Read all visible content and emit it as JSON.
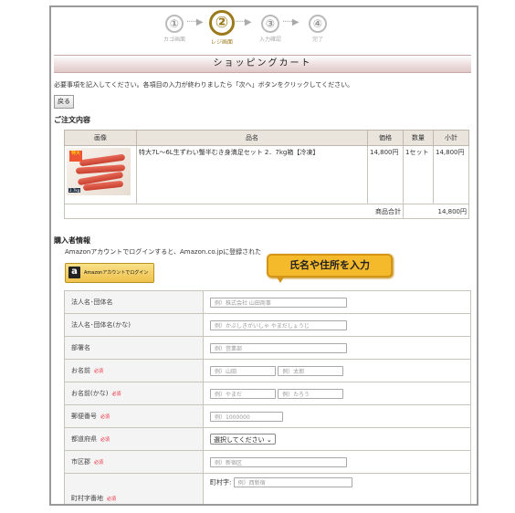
{
  "steps": [
    {
      "num": "①",
      "label": "カゴ画面"
    },
    {
      "num": "②",
      "label": "レジ画面"
    },
    {
      "num": "③",
      "label": "入力確認"
    },
    {
      "num": "④",
      "label": "完了"
    }
  ],
  "arrow": "·····▶",
  "banner_title": "ショッピングカート",
  "instructions": "必要事項を記入してください。各項目の入力が終わりましたら「次へ」ボタンをクリックしてください。",
  "back_label": "戻る",
  "order": {
    "section_title": "ご注文内容",
    "headers": [
      "画像",
      "品名",
      "価格",
      "数量",
      "小計"
    ],
    "item": {
      "name": "特大7L～6L生ずわい蟹半むき身満足セット 2．7kg箱【冷凍】",
      "price": "14,800円",
      "qty": "1セット",
      "subtotal": "14,800円"
    },
    "total_label": "商品合計",
    "total_value": "14,800円"
  },
  "buyer": {
    "section_title": "購入者情報",
    "amazon_hint": "Amazonアカウントでログインすると、Amazon.co.jpに登録された",
    "amazon_button": "Amazonアカウントでログイン",
    "amazon_logo": "a"
  },
  "callout": "氏名や住所を入力",
  "required_mark": "必須",
  "form": {
    "corp_label": "法人名･団体名",
    "corp_ph": "例）株式会社 山田商事",
    "corp_kana_label": "法人名･団体名(かな)",
    "corp_kana_ph": "例）かぶしきがいしゃ やまだしょうじ",
    "dept_label": "部署名",
    "dept_ph": "例）営業部",
    "name_label": "お名前",
    "last_ph": "例）山田",
    "first_ph": "例）太郎",
    "kana_label": "お名前(かな)",
    "last_kana_ph": "例）やまだ",
    "first_kana_ph": "例）たろう",
    "zip_label": "郵便番号",
    "zip_ph": "例）1000000",
    "pref_label": "都道府県",
    "pref_selected": "選択してください",
    "city_label": "市区郡",
    "city_ph": "例）新宿区",
    "town_label": "町村字番地",
    "town_sub": "町村字:",
    "town_ph": "例）西新宿"
  }
}
